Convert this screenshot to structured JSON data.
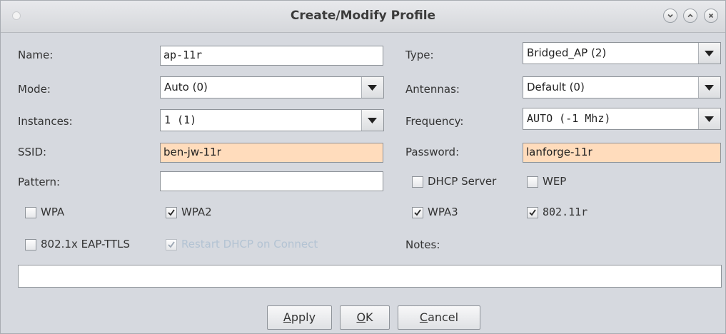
{
  "window": {
    "title": "Create/Modify Profile"
  },
  "form": {
    "name": {
      "label": "Name:",
      "value": "ap-11r"
    },
    "type": {
      "label": "Type:",
      "value": "Bridged_AP (2)"
    },
    "mode": {
      "label": "Mode:",
      "value": "Auto (0)"
    },
    "antennas": {
      "label": "Antennas:",
      "value": "Default (0)"
    },
    "instances": {
      "label": "Instances:",
      "value": "1 (1)"
    },
    "frequency": {
      "label": "Frequency:",
      "value": "AUTO (-1 Mhz)"
    },
    "ssid": {
      "label": "SSID:",
      "value": "ben-jw-11r"
    },
    "password": {
      "label": "Password:",
      "value": "lanforge-11r"
    },
    "pattern": {
      "label": "Pattern:",
      "value": ""
    },
    "notes_label": "Notes:",
    "notes_value": ""
  },
  "checkboxes": {
    "dhcp_server": {
      "label": "DHCP Server",
      "checked": false
    },
    "wep": {
      "label": "WEP",
      "checked": false
    },
    "wpa": {
      "label": "WPA",
      "checked": false
    },
    "wpa2": {
      "label": "WPA2",
      "checked": true
    },
    "wpa3": {
      "label": "WPA3",
      "checked": true
    },
    "r80211": {
      "label": "802.11r",
      "checked": true
    },
    "eap_ttls": {
      "label": "802.1x EAP-TTLS",
      "checked": false
    },
    "restart_dhcp": {
      "label": "Restart DHCP on Connect",
      "checked": true,
      "disabled": true
    }
  },
  "buttons": {
    "apply": {
      "pre": "",
      "mnemonic": "A",
      "post": "pply"
    },
    "ok": {
      "pre": "",
      "mnemonic": "O",
      "post": "K"
    },
    "cancel": {
      "pre": "",
      "mnemonic": "C",
      "post": "ancel"
    }
  },
  "icons": {
    "close": "close-icon",
    "maximize": "maximize-icon",
    "minimize": "minimize-icon",
    "dropdown": "chevron-down-icon",
    "check": "check-icon"
  }
}
